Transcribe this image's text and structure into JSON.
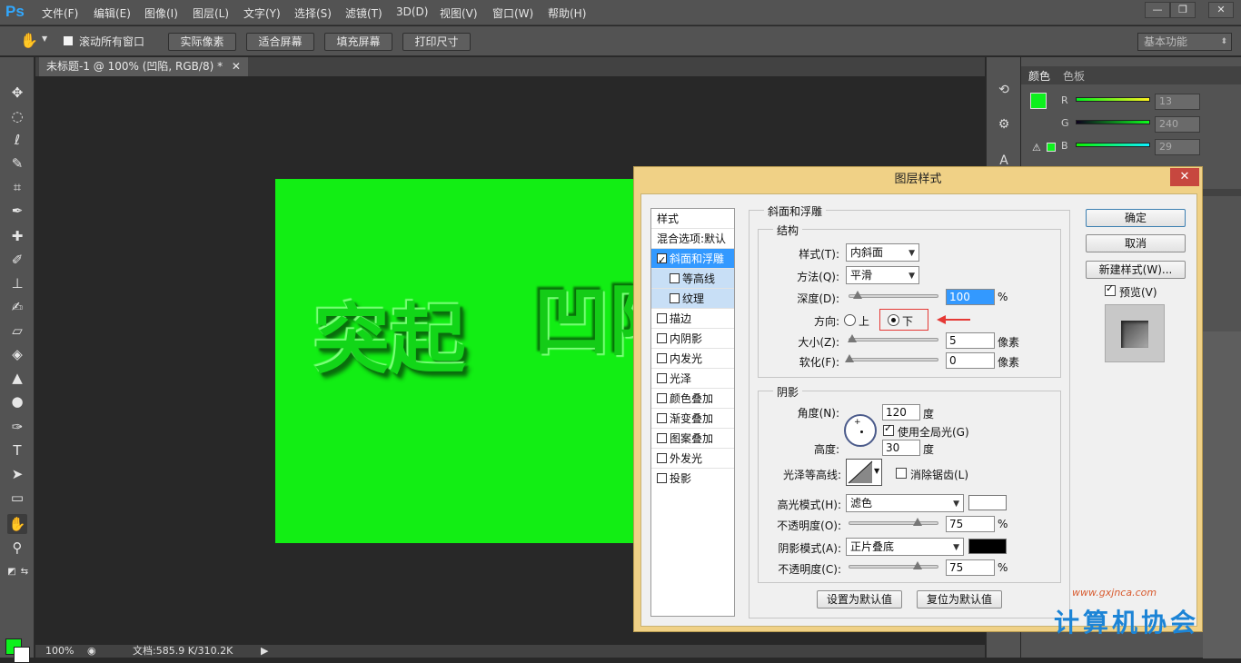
{
  "app": {
    "logo": "Ps"
  },
  "menu": [
    "文件(F)",
    "编辑(E)",
    "图像(I)",
    "图层(L)",
    "文字(Y)",
    "选择(S)",
    "滤镜(T)",
    "3D(D)",
    "视图(V)",
    "窗口(W)",
    "帮助(H)"
  ],
  "options": {
    "scroll_all_label": "滚动所有窗口",
    "actual_pixels": "实际像素",
    "fit_screen": "适合屏幕",
    "fill_screen": "填充屏幕",
    "print_size": "打印尺寸",
    "workspace": "基本功能"
  },
  "document": {
    "tab_title": "未标题-1 @ 100% (凹陷, RGB/8) *",
    "raised_text": "突起",
    "sunken_text": "凹陷",
    "zoom": "100%",
    "doc_size": "文档:585.9 K/310.2K",
    "canvas_color": "#12ee14"
  },
  "color_panel": {
    "tabs": [
      "颜色",
      "色板"
    ],
    "r_label": "R",
    "g_label": "G",
    "b_label": "B",
    "r": "13",
    "g": "240",
    "b": "29",
    "fg_color": "#0df01d",
    "bg_color": "#ffffff"
  },
  "dialog": {
    "title": "图层样式",
    "close": "✕",
    "styles_header": "样式",
    "blend_options": "混合选项:默认",
    "style_items": [
      {
        "label": "斜面和浮雕",
        "checked": true
      },
      {
        "label": "等高线",
        "checked": false
      },
      {
        "label": "纹理",
        "checked": false
      },
      {
        "label": "描边",
        "checked": false
      },
      {
        "label": "内阴影",
        "checked": false
      },
      {
        "label": "内发光",
        "checked": false
      },
      {
        "label": "光泽",
        "checked": false
      },
      {
        "label": "颜色叠加",
        "checked": false
      },
      {
        "label": "渐变叠加",
        "checked": false
      },
      {
        "label": "图案叠加",
        "checked": false
      },
      {
        "label": "外发光",
        "checked": false
      },
      {
        "label": "投影",
        "checked": false
      }
    ],
    "bevel_title": "斜面和浮雕",
    "structure_title": "结构",
    "style_label": "样式(T):",
    "style_value": "内斜面",
    "technique_label": "方法(Q):",
    "technique_value": "平滑",
    "depth_label": "深度(D):",
    "depth_value": "100",
    "percent": "%",
    "direction_label": "方向:",
    "dir_up": "上",
    "dir_down": "下",
    "size_label": "大小(Z):",
    "size_value": "5",
    "soften_label": "软化(F):",
    "soften_value": "0",
    "pixels": "像素",
    "shading_title": "阴影",
    "angle_label": "角度(N):",
    "angle_value": "120",
    "degree": "度",
    "global_light": "使用全局光(G)",
    "altitude_label": "高度:",
    "altitude_value": "30",
    "gloss_label": "光泽等高线:",
    "anti_alias": "消除锯齿(L)",
    "highlight_mode_label": "高光模式(H):",
    "highlight_mode": "滤色",
    "highlight_opacity_label": "不透明度(O):",
    "highlight_opacity": "75",
    "shadow_mode_label": "阴影模式(A):",
    "shadow_mode": "正片叠底",
    "shadow_opacity_label": "不透明度(C):",
    "shadow_opacity": "75",
    "make_default": "设置为默认值",
    "reset_default": "复位为默认值",
    "ok": "确定",
    "cancel": "取消",
    "new_style": "新建样式(W)...",
    "preview": "预览(V)",
    "highlight_color": "#ffffff",
    "shadow_color": "#000000"
  },
  "watermark": {
    "text": "计算机协会",
    "url": "www.gxjnca.com"
  }
}
